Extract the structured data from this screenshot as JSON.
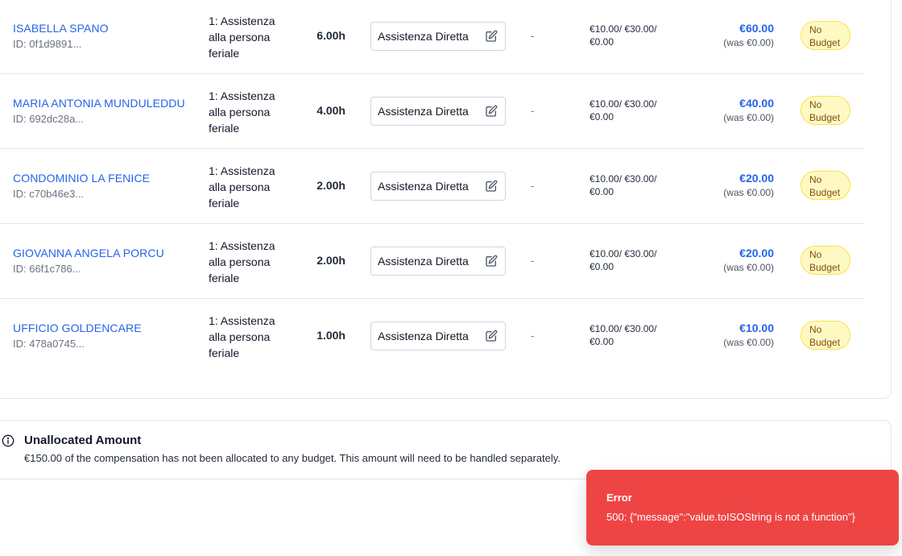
{
  "rows": [
    {
      "client_name": "ISABELLA SPANO",
      "client_id": "ID: 0f1d9891...",
      "service": "1: Assistenza alla persona feriale",
      "hours": "6.00h",
      "service_type": "Assistenza Diretta",
      "extra": "-",
      "rates": "€10.00/ €30.00/ €0.00",
      "amount": "€60.00",
      "was": "(was €0.00)",
      "badge": "No Budget"
    },
    {
      "client_name": "MARIA ANTONIA MUNDULEDDU",
      "client_id": "ID: 692dc28a...",
      "service": "1: Assistenza alla persona feriale",
      "hours": "4.00h",
      "service_type": "Assistenza Diretta",
      "extra": "-",
      "rates": "€10.00/ €30.00/ €0.00",
      "amount": "€40.00",
      "was": "(was €0.00)",
      "badge": "No Budget"
    },
    {
      "client_name": "CONDOMINIO LA FENICE",
      "client_id": "ID: c70b46e3...",
      "service": "1: Assistenza alla persona feriale",
      "hours": "2.00h",
      "service_type": "Assistenza Diretta",
      "extra": "-",
      "rates": "€10.00/ €30.00/ €0.00",
      "amount": "€20.00",
      "was": "(was €0.00)",
      "badge": "No Budget"
    },
    {
      "client_name": "GIOVANNA ANGELA PORCU",
      "client_id": "ID: 66f1c786...",
      "service": "1: Assistenza alla persona feriale",
      "hours": "2.00h",
      "service_type": "Assistenza Diretta",
      "extra": "-",
      "rates": "€10.00/ €30.00/ €0.00",
      "amount": "€20.00",
      "was": "(was €0.00)",
      "badge": "No Budget"
    },
    {
      "client_name": "UFFICIO GOLDENCARE",
      "client_id": "ID: 478a0745...",
      "service": "1: Assistenza alla persona feriale",
      "hours": "1.00h",
      "service_type": "Assistenza Diretta",
      "extra": "-",
      "rates": "€10.00/ €30.00/ €0.00",
      "amount": "€10.00",
      "was": "(was €0.00)",
      "badge": "No Budget"
    }
  ],
  "unallocated": {
    "title": "Unallocated Amount",
    "message": "€150.00 of the compensation has not been allocated to any budget. This amount will need to be handled separately."
  },
  "toast": {
    "title": "Error",
    "message": "500: {\"message\":\"value.toISOString is not a function\"}"
  },
  "colors": {
    "link": "#2563eb",
    "badge_bg": "#fef9c3",
    "badge_text": "#854d0e",
    "error_bg": "#ef4444"
  },
  "icons": {
    "edit": "pencil-square-icon",
    "info": "info-circle-icon"
  }
}
